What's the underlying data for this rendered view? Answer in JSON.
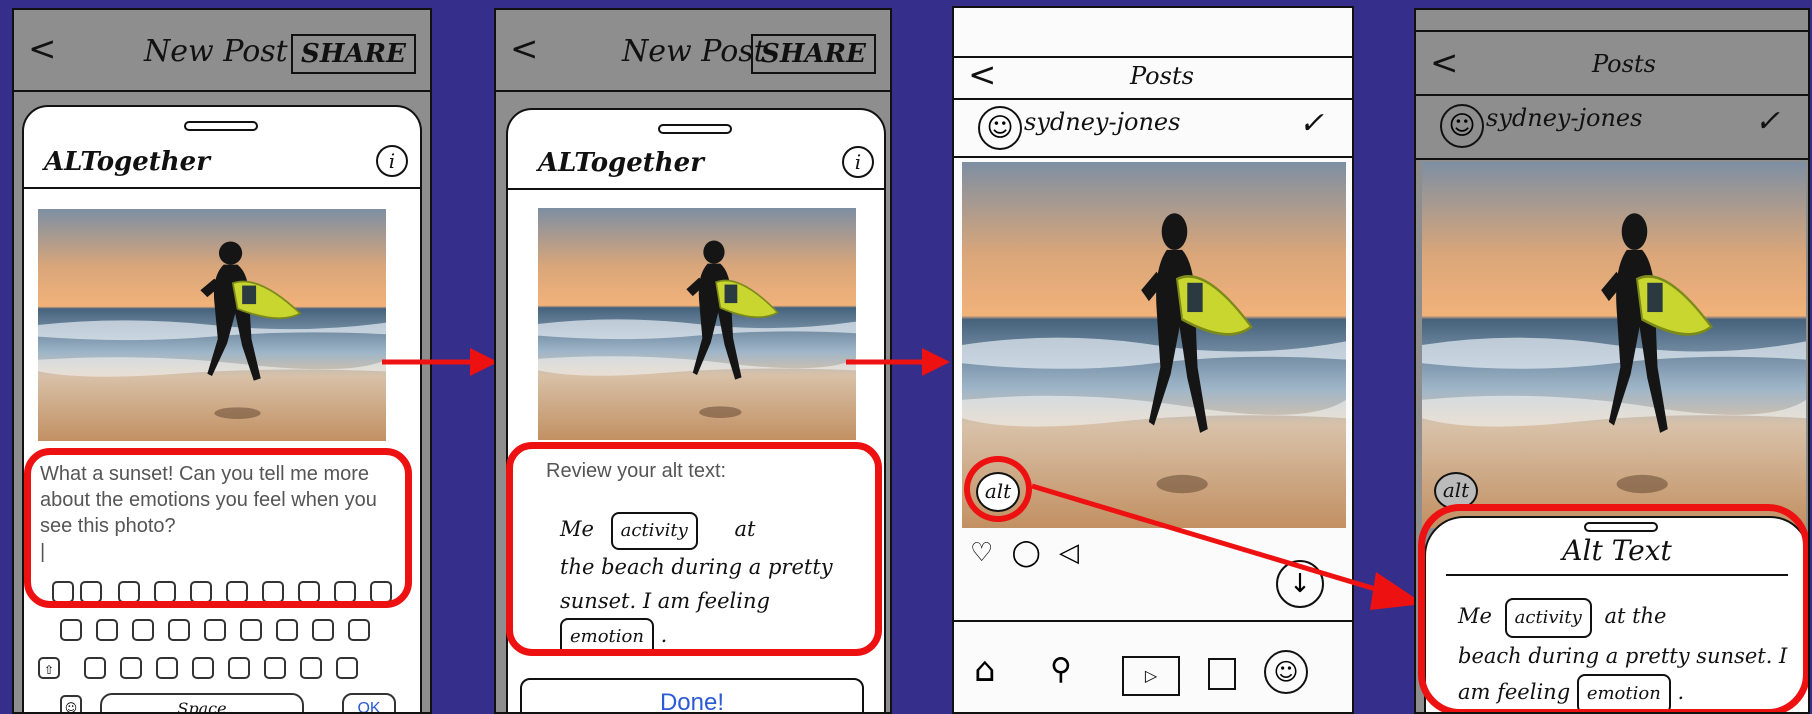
{
  "screens": [
    {
      "header": {
        "back_glyph": "<",
        "title": "New Post",
        "share_label": "SHARE"
      },
      "sheet": {
        "brand": "ALTogether",
        "info_glyph": "i"
      },
      "prompt": {
        "text": "What a sunset! Can you tell me more about the emotions you feel when you see this photo?",
        "cursor": "|"
      },
      "keyboard": {
        "space_label": "Space",
        "ok_label": "OK"
      }
    },
    {
      "header": {
        "back_glyph": "<",
        "title": "New Post",
        "share_label": "SHARE"
      },
      "sheet": {
        "brand": "ALTogether",
        "info_glyph": "i"
      },
      "review": {
        "heading": "Review your alt text:",
        "line1_pre": "Me",
        "chip_activity": "activity",
        "line1_post": "at",
        "line2": "the beach during a pretty",
        "line3": "sunset. I am feeling",
        "chip_emotion": "emotion",
        "end": "."
      },
      "done_label": "Done!"
    },
    {
      "header": {
        "back_glyph": "<",
        "title": "Posts"
      },
      "user": {
        "username": "sydney-jones",
        "check_glyph": "✓"
      },
      "alt_badge": "alt"
    },
    {
      "header": {
        "back_glyph": "<",
        "title": "Posts"
      },
      "user": {
        "username": "sydney-jones",
        "check_glyph": "✓"
      },
      "alt_badge": "alt",
      "alt_sheet": {
        "title": "Alt Text",
        "pre": "Me",
        "chip_activity": "activity",
        "text1": "at the",
        "text2": "beach during a pretty sunset. I",
        "text3": "am feeling",
        "chip_emotion": "emotion",
        "end": "."
      }
    }
  ],
  "colors": {
    "background": "#352e8a",
    "highlight": "#ee1111",
    "done_text": "#2a5ad6"
  }
}
